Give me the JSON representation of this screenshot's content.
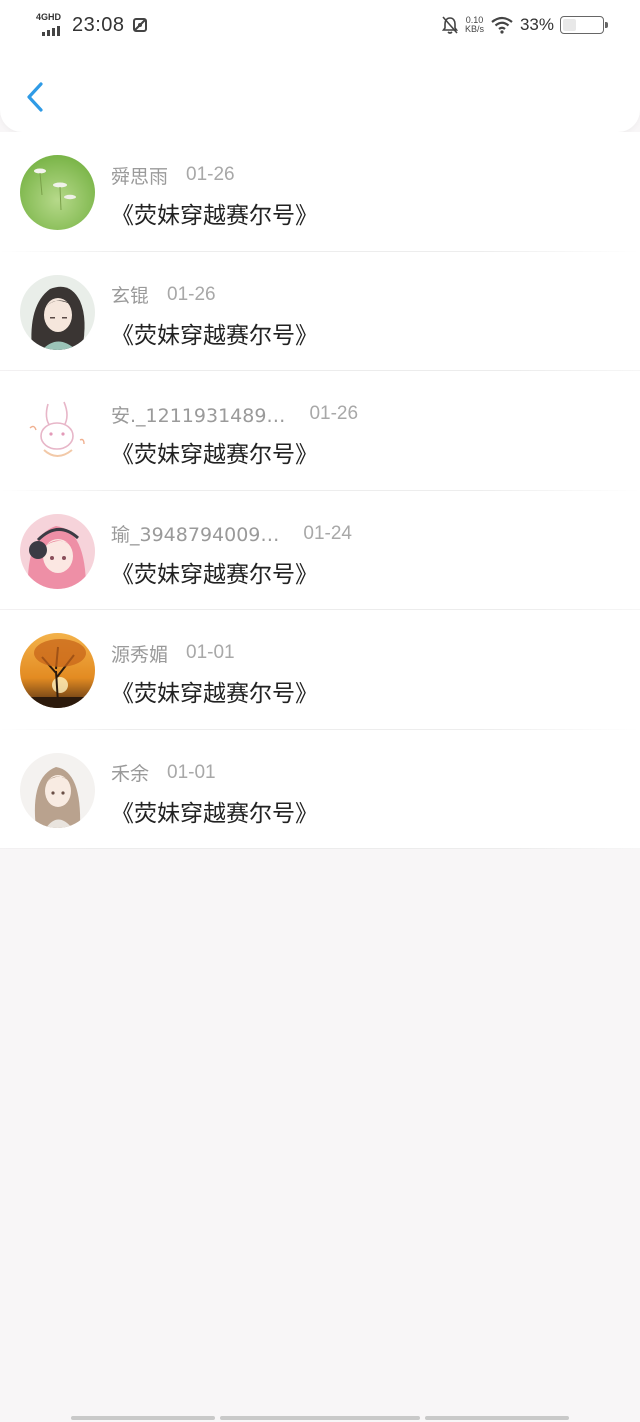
{
  "status_bar": {
    "network": "4GHD",
    "time": "23:08",
    "speed_value": "0.10",
    "speed_unit": "KB/s",
    "battery_percent": "33%",
    "battery_level": 0.33
  },
  "messages": [
    {
      "name": "舜思雨",
      "date": "01-26",
      "title": "《荧妹穿越赛尔号》",
      "avatar": "flower-field-avatar"
    },
    {
      "name": "玄锟",
      "date": "01-26",
      "title": "《荧妹穿越赛尔号》",
      "avatar": "anime-girl-dark-hair-avatar"
    },
    {
      "name": "安._1211931489…",
      "date": "01-26",
      "title": "《荧妹穿越赛尔号》",
      "avatar": "bunny-sketch-avatar"
    },
    {
      "name": "瑜_3948794009…",
      "date": "01-24",
      "title": "《荧妹穿越赛尔号》",
      "avatar": "anime-girl-headphones-avatar"
    },
    {
      "name": "源秀媚",
      "date": "01-01",
      "title": "《荧妹穿越赛尔号》",
      "avatar": "autumn-tree-avatar"
    },
    {
      "name": "禾余",
      "date": "01-01",
      "title": "《荧妹穿越赛尔号》",
      "avatar": "anime-girl-long-hair-avatar"
    }
  ],
  "colors": {
    "accent": "#2f9be6",
    "background": "#f8f6f7"
  }
}
